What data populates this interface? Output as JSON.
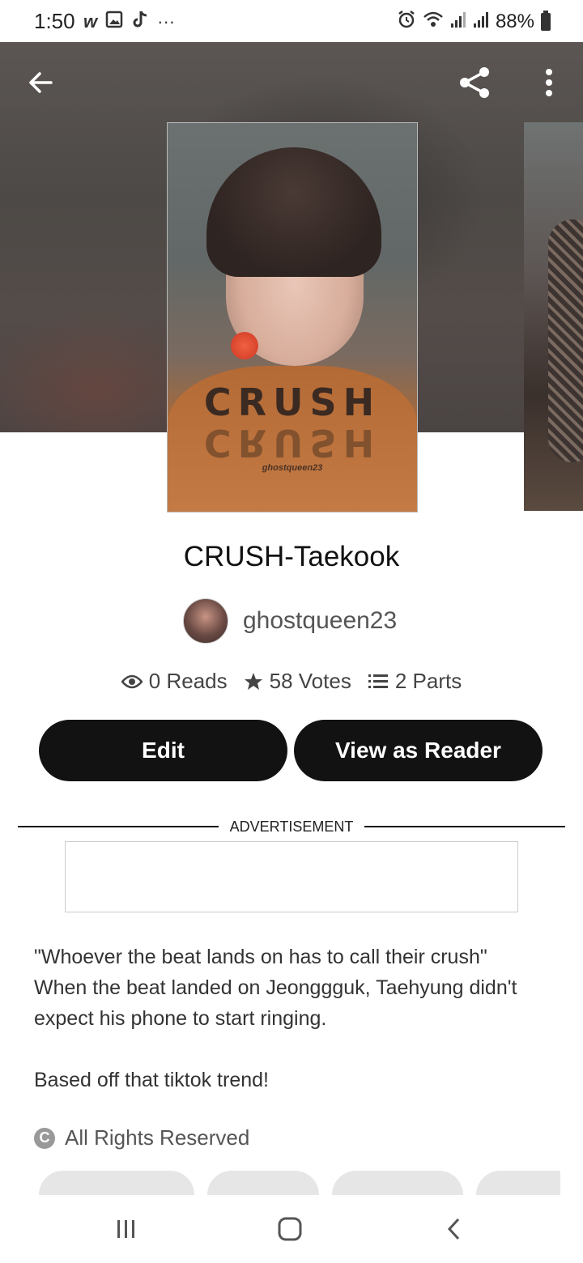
{
  "status_bar": {
    "time": "1:50",
    "battery": "88%",
    "left_icons": [
      "wattpad-icon",
      "gallery-icon",
      "tiktok-icon",
      "more-icon"
    ],
    "right_icons": [
      "alarm-icon",
      "wifi-icon",
      "signal-icon",
      "signal-icon",
      "battery-icon"
    ]
  },
  "header": {
    "back_icon": "arrow-left-icon",
    "share_icon": "share-icon",
    "more_icon": "vertical-dots-icon"
  },
  "cover": {
    "title": "CRUSH",
    "author": "ghostqueen23"
  },
  "story": {
    "title": "CRUSH-Taekook",
    "author": "ghostqueen23",
    "reads": "0 Reads",
    "votes": "58 Votes",
    "parts": "2 Parts"
  },
  "buttons": {
    "edit": "Edit",
    "reader": "View as Reader"
  },
  "ad": {
    "label": "ADVERTISEMENT"
  },
  "description": "\"Whoever the beat lands on has to call their crush\"\nWhen the beat landed on Jeonggguk, Taehyung didn't expect his phone to start ringing.\n\nBased off that tiktok trend!",
  "rights": "All Rights Reserved",
  "colors": {
    "button_bg": "#121212",
    "text": "#222222"
  }
}
